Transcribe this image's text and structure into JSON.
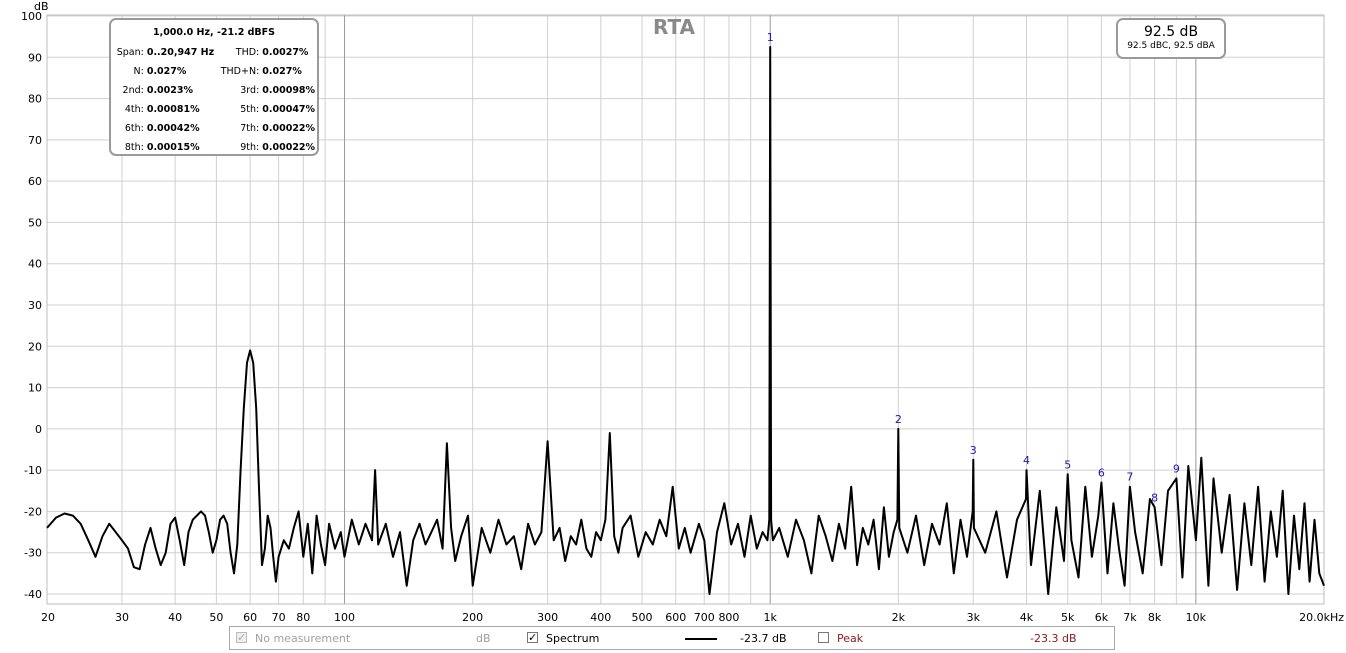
{
  "title": "RTA",
  "y_unit": "dB",
  "stats": {
    "header": "1,000.0 Hz, -21.2 dBFS",
    "rows": [
      {
        "l1": "Span:",
        "v1": "0..20,947 Hz",
        "l2": "THD:",
        "v2": "0.0027%"
      },
      {
        "l1": "N:",
        "v1": "0.027%",
        "l2": "THD+N:",
        "v2": "0.027%"
      },
      {
        "l1": "2nd:",
        "v1": "0.0023%",
        "l2": "3rd:",
        "v2": "0.00098%"
      },
      {
        "l1": "4th:",
        "v1": "0.00081%",
        "l2": "5th:",
        "v2": "0.00047%"
      },
      {
        "l1": "6th:",
        "v1": "0.00042%",
        "l2": "7th:",
        "v2": "0.00022%"
      },
      {
        "l1": "8th:",
        "v1": "0.00015%",
        "l2": "9th:",
        "v2": "0.00022%"
      }
    ]
  },
  "spl": {
    "main": "92.5 dB",
    "sub": "92.5 dBC, 92.5 dBA"
  },
  "legend": {
    "no_measurement": "No measurement",
    "no_measurement_unit": "dB",
    "spectrum_label": "Spectrum",
    "spectrum_value": "-23.7 dB",
    "peak_label": "Peak",
    "peak_value": "-23.3 dB",
    "peak_color": "#8b1a1a"
  },
  "chart_data": {
    "type": "line",
    "x_scale": "log",
    "xlim": [
      20,
      20000
    ],
    "ylim": [
      -42,
      100
    ],
    "x_ticks": [
      {
        "v": 20,
        "t": "20"
      },
      {
        "v": 30,
        "t": "30"
      },
      {
        "v": 40,
        "t": "40"
      },
      {
        "v": 50,
        "t": "50"
      },
      {
        "v": 60,
        "t": "60"
      },
      {
        "v": 70,
        "t": "70"
      },
      {
        "v": 80,
        "t": "80"
      },
      {
        "v": 100,
        "t": "100"
      },
      {
        "v": 200,
        "t": "200"
      },
      {
        "v": 300,
        "t": "300"
      },
      {
        "v": 400,
        "t": "400"
      },
      {
        "v": 500,
        "t": "500"
      },
      {
        "v": 600,
        "t": "600"
      },
      {
        "v": 700,
        "t": "700"
      },
      {
        "v": 800,
        "t": "800"
      },
      {
        "v": 1000,
        "t": "1k"
      },
      {
        "v": 2000,
        "t": "2k"
      },
      {
        "v": 3000,
        "t": "3k"
      },
      {
        "v": 4000,
        "t": "4k"
      },
      {
        "v": 5000,
        "t": "5k"
      },
      {
        "v": 6000,
        "t": "6k"
      },
      {
        "v": 7000,
        "t": "7k"
      },
      {
        "v": 8000,
        "t": "8k"
      },
      {
        "v": 10000,
        "t": "10k"
      },
      {
        "v": 20000,
        "t": "20.0kHz"
      }
    ],
    "y_ticks": [
      100,
      90,
      80,
      70,
      60,
      50,
      40,
      30,
      20,
      10,
      0,
      -10,
      -20,
      -30,
      -40
    ],
    "harmonic_markers": [
      {
        "label": "1",
        "x": 1000,
        "y": 92.5
      },
      {
        "label": "2",
        "x": 2000,
        "y": 0
      },
      {
        "label": "3",
        "x": 3000,
        "y": -7.5
      },
      {
        "label": "4",
        "x": 4000,
        "y": -10
      },
      {
        "label": "5",
        "x": 5000,
        "y": -11
      },
      {
        "label": "6",
        "x": 6000,
        "y": -13
      },
      {
        "label": "7",
        "x": 7000,
        "y": -14
      },
      {
        "label": "8",
        "x": 8000,
        "y": -19
      },
      {
        "label": "9",
        "x": 9000,
        "y": -12
      }
    ],
    "series": [
      {
        "color": "#000000",
        "points": [
          [
            20,
            -24
          ],
          [
            21,
            -21.5
          ],
          [
            22,
            -20.5
          ],
          [
            23,
            -21
          ],
          [
            24,
            -23
          ],
          [
            25,
            -27
          ],
          [
            26,
            -31
          ],
          [
            27,
            -26
          ],
          [
            28,
            -23
          ],
          [
            29,
            -25
          ],
          [
            30,
            -27
          ],
          [
            31,
            -29
          ],
          [
            32,
            -33.5
          ],
          [
            33,
            -34
          ],
          [
            34,
            -28
          ],
          [
            35,
            -24
          ],
          [
            36,
            -29
          ],
          [
            37,
            -33
          ],
          [
            38,
            -30
          ],
          [
            39,
            -23
          ],
          [
            40,
            -21.5
          ],
          [
            41,
            -27
          ],
          [
            42,
            -33
          ],
          [
            43,
            -25
          ],
          [
            44,
            -22
          ],
          [
            45,
            -21
          ],
          [
            46,
            -20
          ],
          [
            47,
            -21
          ],
          [
            48,
            -25
          ],
          [
            49,
            -30
          ],
          [
            50,
            -27
          ],
          [
            51,
            -22
          ],
          [
            52,
            -21
          ],
          [
            53,
            -23
          ],
          [
            54,
            -30
          ],
          [
            55,
            -35
          ],
          [
            56,
            -28
          ],
          [
            57,
            -10
          ],
          [
            58,
            5
          ],
          [
            59,
            16
          ],
          [
            60,
            19
          ],
          [
            61,
            16
          ],
          [
            62,
            5
          ],
          [
            63,
            -15
          ],
          [
            64,
            -33
          ],
          [
            65,
            -29
          ],
          [
            66,
            -21
          ],
          [
            67,
            -24
          ],
          [
            68,
            -31
          ],
          [
            69,
            -37
          ],
          [
            70,
            -31
          ],
          [
            72,
            -27
          ],
          [
            74,
            -29
          ],
          [
            76,
            -24
          ],
          [
            78,
            -20
          ],
          [
            80,
            -31
          ],
          [
            82,
            -23
          ],
          [
            84,
            -35
          ],
          [
            86,
            -21
          ],
          [
            88,
            -28
          ],
          [
            90,
            -33
          ],
          [
            92,
            -23
          ],
          [
            95,
            -29
          ],
          [
            98,
            -25
          ],
          [
            100,
            -31
          ],
          [
            104,
            -22
          ],
          [
            108,
            -28
          ],
          [
            112,
            -23
          ],
          [
            116,
            -27
          ],
          [
            118,
            -10
          ],
          [
            120,
            -28
          ],
          [
            125,
            -23
          ],
          [
            130,
            -31
          ],
          [
            135,
            -25
          ],
          [
            140,
            -38
          ],
          [
            145,
            -27
          ],
          [
            150,
            -23
          ],
          [
            155,
            -28
          ],
          [
            160,
            -25
          ],
          [
            165,
            -22
          ],
          [
            170,
            -29
          ],
          [
            174,
            -3.5
          ],
          [
            178,
            -24
          ],
          [
            182,
            -32
          ],
          [
            188,
            -26
          ],
          [
            195,
            -21
          ],
          [
            200,
            -38
          ],
          [
            210,
            -24
          ],
          [
            220,
            -30
          ],
          [
            230,
            -22
          ],
          [
            240,
            -28
          ],
          [
            250,
            -26
          ],
          [
            260,
            -34
          ],
          [
            270,
            -23
          ],
          [
            280,
            -28
          ],
          [
            290,
            -25
          ],
          [
            300,
            -3
          ],
          [
            310,
            -27
          ],
          [
            320,
            -24
          ],
          [
            330,
            -32
          ],
          [
            340,
            -26
          ],
          [
            350,
            -28
          ],
          [
            360,
            -22
          ],
          [
            370,
            -29
          ],
          [
            380,
            -31
          ],
          [
            390,
            -25
          ],
          [
            400,
            -27
          ],
          [
            410,
            -22
          ],
          [
            420,
            -1
          ],
          [
            430,
            -26
          ],
          [
            440,
            -30
          ],
          [
            450,
            -24
          ],
          [
            470,
            -21
          ],
          [
            490,
            -31
          ],
          [
            510,
            -25
          ],
          [
            530,
            -28
          ],
          [
            550,
            -22
          ],
          [
            570,
            -26
          ],
          [
            590,
            -14
          ],
          [
            610,
            -29
          ],
          [
            630,
            -24
          ],
          [
            650,
            -30
          ],
          [
            680,
            -23
          ],
          [
            700,
            -27
          ],
          [
            720,
            -40
          ],
          [
            750,
            -25
          ],
          [
            780,
            -18
          ],
          [
            810,
            -28
          ],
          [
            840,
            -23
          ],
          [
            870,
            -31
          ],
          [
            900,
            -21
          ],
          [
            930,
            -29
          ],
          [
            960,
            -25
          ],
          [
            985,
            -27
          ],
          [
            995,
            -22
          ],
          [
            1000,
            92.5
          ],
          [
            1005,
            -22
          ],
          [
            1015,
            -27
          ],
          [
            1050,
            -24
          ],
          [
            1100,
            -31
          ],
          [
            1150,
            -22
          ],
          [
            1200,
            -27
          ],
          [
            1250,
            -35
          ],
          [
            1300,
            -21
          ],
          [
            1350,
            -26
          ],
          [
            1400,
            -32
          ],
          [
            1450,
            -23
          ],
          [
            1500,
            -29
          ],
          [
            1550,
            -14
          ],
          [
            1600,
            -33
          ],
          [
            1650,
            -24
          ],
          [
            1700,
            -28
          ],
          [
            1750,
            -22
          ],
          [
            1800,
            -34
          ],
          [
            1850,
            -19
          ],
          [
            1900,
            -31
          ],
          [
            1950,
            -25
          ],
          [
            1990,
            -22
          ],
          [
            2000,
            0
          ],
          [
            2010,
            -24
          ],
          [
            2100,
            -30
          ],
          [
            2200,
            -21
          ],
          [
            2300,
            -33
          ],
          [
            2400,
            -23
          ],
          [
            2500,
            -28
          ],
          [
            2600,
            -18
          ],
          [
            2700,
            -35
          ],
          [
            2800,
            -22
          ],
          [
            2900,
            -31
          ],
          [
            2990,
            -20
          ],
          [
            3000,
            -7.5
          ],
          [
            3010,
            -24
          ],
          [
            3200,
            -30
          ],
          [
            3400,
            -20
          ],
          [
            3600,
            -36
          ],
          [
            3800,
            -22
          ],
          [
            3990,
            -17
          ],
          [
            4000,
            -10
          ],
          [
            4100,
            -33
          ],
          [
            4300,
            -15
          ],
          [
            4500,
            -40
          ],
          [
            4700,
            -19
          ],
          [
            4900,
            -32
          ],
          [
            5000,
            -11
          ],
          [
            5100,
            -27
          ],
          [
            5300,
            -36
          ],
          [
            5500,
            -14
          ],
          [
            5700,
            -31
          ],
          [
            5900,
            -21
          ],
          [
            6000,
            -13
          ],
          [
            6200,
            -35
          ],
          [
            6400,
            -18
          ],
          [
            6600,
            -29
          ],
          [
            6800,
            -38
          ],
          [
            7000,
            -14
          ],
          [
            7200,
            -25
          ],
          [
            7500,
            -35
          ],
          [
            7800,
            -17
          ],
          [
            8000,
            -19
          ],
          [
            8300,
            -33
          ],
          [
            8600,
            -15
          ],
          [
            9000,
            -12
          ],
          [
            9300,
            -36
          ],
          [
            9600,
            -9
          ],
          [
            10000,
            -27
          ],
          [
            10300,
            -7
          ],
          [
            10700,
            -38
          ],
          [
            11000,
            -12
          ],
          [
            11500,
            -30
          ],
          [
            12000,
            -16
          ],
          [
            12500,
            -39
          ],
          [
            13000,
            -18
          ],
          [
            13500,
            -33
          ],
          [
            14000,
            -14
          ],
          [
            14500,
            -37
          ],
          [
            15000,
            -20
          ],
          [
            15500,
            -31
          ],
          [
            16000,
            -15
          ],
          [
            16500,
            -40
          ],
          [
            17000,
            -21
          ],
          [
            17500,
            -34
          ],
          [
            18000,
            -18
          ],
          [
            18500,
            -37
          ],
          [
            19000,
            -22
          ],
          [
            19500,
            -35
          ],
          [
            20000,
            -38
          ]
        ]
      }
    ]
  }
}
